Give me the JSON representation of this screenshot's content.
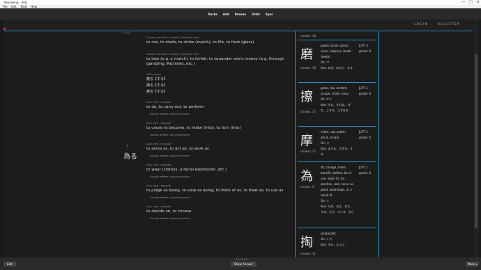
{
  "window": {
    "title": "Reviewing - Anki",
    "min": "—",
    "max": "□",
    "close": "✕"
  },
  "menu": [
    "File",
    "Edit",
    "Tools",
    "Help"
  ],
  "nav": [
    "Decks",
    "Add",
    "Browse",
    "Stats",
    "Sync"
  ],
  "auth": {
    "login": "LOGIN",
    "register": "REGISTER"
  },
  "fragment": "ｽﾞﾝｱ ｽﾞ",
  "word": {
    "furigana": "す",
    "text": "為る"
  },
  "senses": [
    {
      "pos": "Godan verb with ru ending, Transitive verb",
      "gloss": "to rub, to chafe, to strike (match), to file, to frost (glass)",
      "note": ""
    },
    {
      "pos": "Godan verb with ru ending, Transitive verb",
      "gloss": "to lose (e.g. a match), to forfeit, to squander one's money (e.g. through gambling, Pachinko, etc.)",
      "note": ""
    },
    {
      "pos": "Suru verb - irregular",
      "gloss": "to do, to carry out, to perform",
      "note": "Usually written using kana alone"
    },
    {
      "pos": "Suru verb - irregular",
      "gloss": "to cause to become, to make (into), to turn (into)",
      "note": "Usually written using kana alone"
    },
    {
      "pos": "Suru verb - irregular",
      "gloss": "to serve as, to act as, to work as",
      "note": "Usually written using kana alone"
    },
    {
      "pos": "Suru verb - irregular",
      "gloss": "to wear (clothes, a facial expression, etc.)",
      "note": "Usually written using kana alone"
    },
    {
      "pos": "Suru verb - irregular",
      "gloss": "to judge as being, to view as being, to think of as, to treat as, to use as",
      "note": "Usually written using kana alone"
    },
    {
      "pos": "Suru verb - irregular",
      "gloss": "to decide on, to choose",
      "note": "Usually written using kana alone"
    }
  ],
  "other_forms": {
    "label": "Other forms",
    "items": [
      "磨る【する】",
      "擦る【する】",
      "摩る【する】"
    ]
  },
  "kanji_cards": [
    {
      "strokes": "strokes: 16",
      "kanji": "",
      "meanings": "",
      "on": "",
      "kun": "",
      "jlpt": "",
      "grade": ""
    },
    {
      "kanji": "磨",
      "strokes": "strokes: 16",
      "meanings": "polish, brush, grind, scour, improve, brush (teeth)",
      "on": "On: マ",
      "kun": "Kun: みが、みがく、する",
      "jlpt": "JLPT: 2",
      "grade": "grade: 8"
    },
    {
      "kanji": "擦",
      "strokes": "strokes: 17",
      "meanings": "grate, rub, scratch, scrape, chafe, scour",
      "on": "On: サツ",
      "kun": "Kun: する、すれる、-ずれ、こする、こすれる",
      "jlpt": "JLPT: 1",
      "grade": "grade: 8"
    },
    {
      "kanji": "摩",
      "strokes": "strokes: 15",
      "meanings": "chafe, rub, polish, grind, scrape",
      "on": "On: マ",
      "kun": "Kun: まする、さする、する",
      "jlpt": "JLPT: 1",
      "grade": "grade: 8"
    },
    {
      "kanji": "為",
      "strokes": "strokes: 9",
      "meanings": "do, change, make, benefit, welfare, be of use, reach to, try, practice, cost, serve as, good, advantage, as a result of",
      "on": "On: イ",
      "kun": "Kun: ため、なる、なす、する、たり、つくる、なり",
      "jlpt": "JLPT: 1",
      "grade": "grade: 8"
    },
    {
      "kanji": "掏",
      "strokes": "strokes: 11",
      "meanings": "pickpocket",
      "on": "On: トウ",
      "kun": "Kun: する、えらぶ",
      "jlpt": "",
      "grade": ""
    }
  ],
  "bottom": {
    "edit": "Edit",
    "show_answer": "Show Answer",
    "counter": "1 + 0 + 1",
    "more": "More ▾"
  }
}
